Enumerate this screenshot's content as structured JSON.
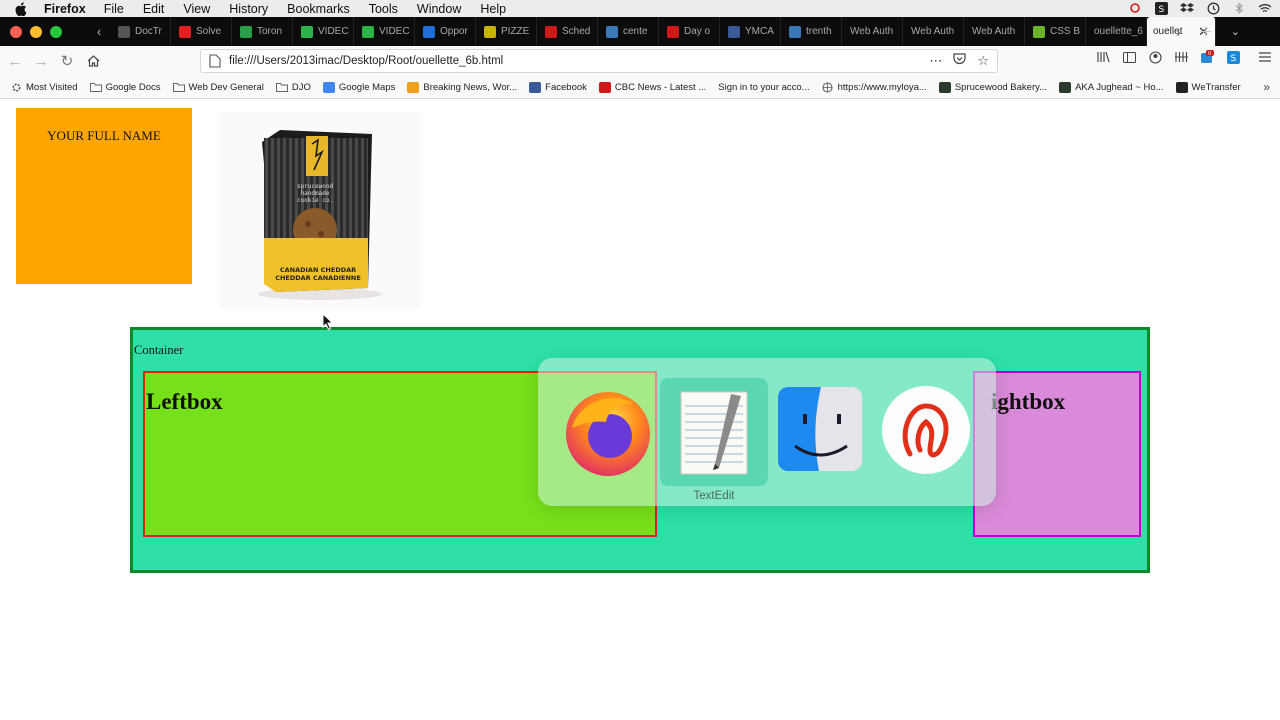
{
  "menubar": {
    "app_name": "Firefox",
    "items": [
      "File",
      "Edit",
      "View",
      "History",
      "Bookmarks",
      "Tools",
      "Window",
      "Help"
    ]
  },
  "tabs": [
    {
      "label": "DocTr",
      "icon": "doc-icon",
      "color": "#555"
    },
    {
      "label": "Solve",
      "icon": "pdf-icon",
      "color": "#e02020"
    },
    {
      "label": "Toron",
      "icon": "map-pin-icon",
      "color": "#2a9d4a"
    },
    {
      "label": "VIDEC",
      "icon": "video-icon",
      "color": "#2cb34a"
    },
    {
      "label": "VIDEC",
      "icon": "video-icon",
      "color": "#2cb34a"
    },
    {
      "label": "Oppor",
      "icon": "e-icon",
      "color": "#1f6fd6"
    },
    {
      "label": "PIZZE",
      "icon": "c-icon",
      "color": "#c8b400"
    },
    {
      "label": "Sched",
      "icon": "y-icon",
      "color": "#d01a1a"
    },
    {
      "label": "cente",
      "icon": "wordpress-icon",
      "color": "#3a78b8"
    },
    {
      "label": "Day o",
      "icon": "play-icon",
      "color": "#d01a1a"
    },
    {
      "label": "YMCA",
      "icon": "facebook-icon",
      "color": "#3b5998"
    },
    {
      "label": "trenth",
      "icon": "wordpress-icon",
      "color": "#3a78b8"
    },
    {
      "label": "Web Auth",
      "icon": "",
      "color": ""
    },
    {
      "label": "Web Auth",
      "icon": "",
      "color": ""
    },
    {
      "label": "Web Auth",
      "icon": "",
      "color": ""
    },
    {
      "label": "CSS B",
      "icon": "css-icon",
      "color": "#6bb32a"
    },
    {
      "label": "ouellette_6",
      "icon": "",
      "color": ""
    }
  ],
  "active_tab": {
    "label": "ouellet"
  },
  "navbar": {
    "url": "file:///Users/2013imac/Desktop/Root/ouellette_6b.html"
  },
  "bookmarks": [
    {
      "label": "Most Visited",
      "icon": "gear-icon",
      "color": "#666"
    },
    {
      "label": "Google Docs",
      "icon": "folder-icon",
      "color": "#888"
    },
    {
      "label": "Web Dev General",
      "icon": "folder-icon",
      "color": "#888"
    },
    {
      "label": "DJO",
      "icon": "folder-icon",
      "color": "#888"
    },
    {
      "label": "Google Maps",
      "icon": "google-icon",
      "color": "#4285f4"
    },
    {
      "label": "Breaking News, Wor...",
      "icon": "news-icon",
      "color": "#f0a020"
    },
    {
      "label": "Facebook",
      "icon": "facebook-icon",
      "color": "#3b5998"
    },
    {
      "label": "CBC News - Latest ...",
      "icon": "cbc-icon",
      "color": "#d01a1a"
    },
    {
      "label": "Sign in to your acco...",
      "icon": "",
      "color": ""
    },
    {
      "label": "https://www.myloya...",
      "icon": "globe-icon",
      "color": "#666"
    },
    {
      "label": "Sprucewood Bakery...",
      "icon": "bakery-icon",
      "color": "#2a3a2a"
    },
    {
      "label": "AKA Jughead ~ Ho...",
      "icon": "bakery-icon",
      "color": "#2a3a2a"
    },
    {
      "label": "WeTransfer",
      "icon": "wetransfer-icon",
      "color": "#222"
    }
  ],
  "page": {
    "name_box": "YOUR FULL NAME",
    "product_brand": "sprucewood handmade cookie co.",
    "product_flavor_en": "CANADIAN CHEDDAR",
    "product_flavor_fr": "CHEDDAR CANADIENNE",
    "container_label": "Container",
    "leftbox_title": "Leftbox",
    "rightbox_title": "ightbox"
  },
  "switcher": {
    "apps": [
      {
        "name": "firefox-icon"
      },
      {
        "name": "textedit-icon",
        "label": "TextEdit"
      },
      {
        "name": "finder-icon"
      },
      {
        "name": "acrobat-icon"
      }
    ],
    "selected_label": "TextEdit"
  }
}
